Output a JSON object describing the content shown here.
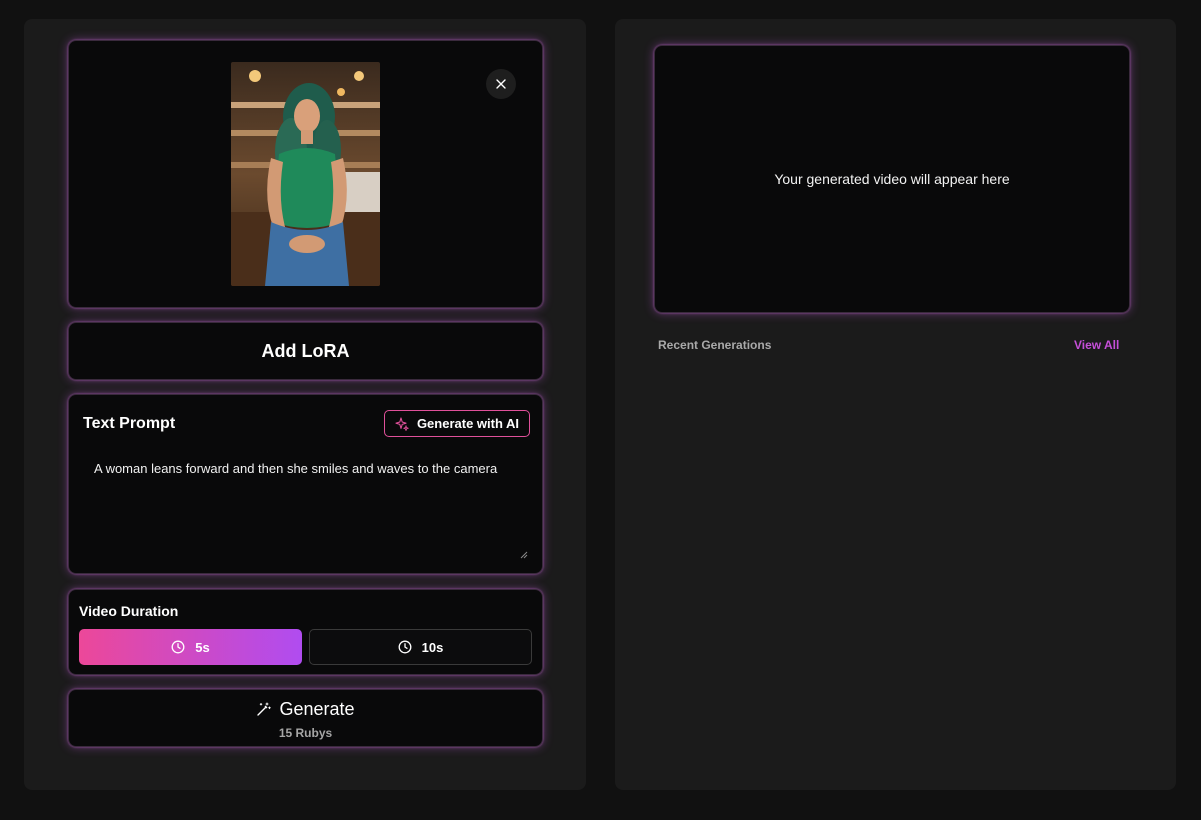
{
  "image_card": {
    "preview_alt": "Woman in green tank top sitting at a cafe counter",
    "close_icon": "close-icon"
  },
  "lora": {
    "label": "Add LoRA"
  },
  "prompt": {
    "title": "Text Prompt",
    "ai_button_label": "Generate with AI",
    "ai_icon": "sparkles-icon",
    "text": "A woman leans forward and then she smiles and waves to the camera"
  },
  "duration": {
    "title": "Video Duration",
    "options": [
      {
        "label": "5s",
        "icon": "clock-icon",
        "selected": true
      },
      {
        "label": "10s",
        "icon": "clock-icon",
        "selected": false
      }
    ]
  },
  "generate": {
    "label": "Generate",
    "icon": "magic-wand-icon",
    "cost": "15 Rubys"
  },
  "video": {
    "placeholder": "Your generated video will appear here"
  },
  "recent": {
    "title": "Recent Generations",
    "view_all": "View All"
  },
  "colors": {
    "background": "#111111",
    "panel": "#1b1b1b",
    "card": "#09090a",
    "accent_pink": "#ec4899",
    "accent_purple": "#b04cf0",
    "link": "#c54fd8"
  }
}
